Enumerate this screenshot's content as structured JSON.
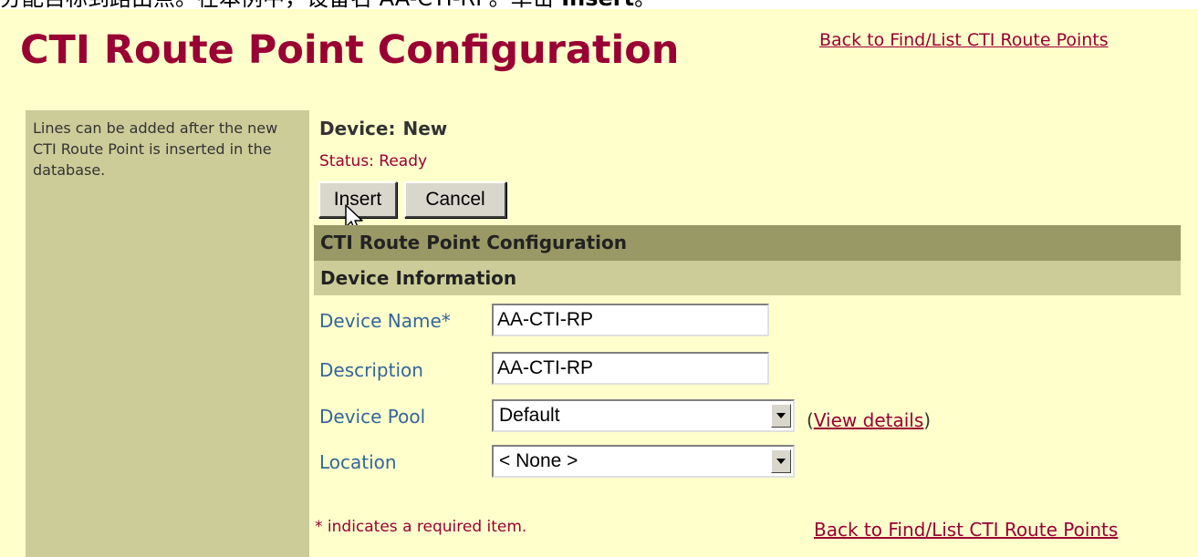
{
  "top_caption": {
    "text": "分配目标到路由点。在本例中，设备名 AA-CTI-RP。单击 ",
    "bold": "Insert",
    "end": "。"
  },
  "header": {
    "title": "CTI Route Point Configuration",
    "back_link": "Back to Find/List CTI Route Points"
  },
  "sidebar": {
    "note": "Lines can be added after the new CTI Route Point is inserted in the database."
  },
  "device": {
    "label": "Device:",
    "value": "New",
    "status": "Status: Ready"
  },
  "buttons": {
    "insert": "Insert",
    "cancel": "Cancel"
  },
  "sections": {
    "main": "CTI Route Point Configuration",
    "device_info": "Device Information"
  },
  "fields": {
    "device_name": {
      "label": "Device Name*",
      "value": "AA-CTI-RP"
    },
    "description": {
      "label": "Description",
      "value": "AA-CTI-RP"
    },
    "device_pool": {
      "label": "Device Pool",
      "value": "Default"
    },
    "location": {
      "label": "Location",
      "value": "< None >"
    }
  },
  "view_details": {
    "open": "(",
    "link": "View details",
    "close": ")"
  },
  "footer": {
    "required_note": "* indicates a required item.",
    "back_link": "Back to Find/List CTI Route Points"
  },
  "colors": {
    "page_bg": "#ffffcc",
    "title": "#990033",
    "sidebar_bg": "#cccc99",
    "section_dark": "#999966",
    "label": "#336699"
  }
}
